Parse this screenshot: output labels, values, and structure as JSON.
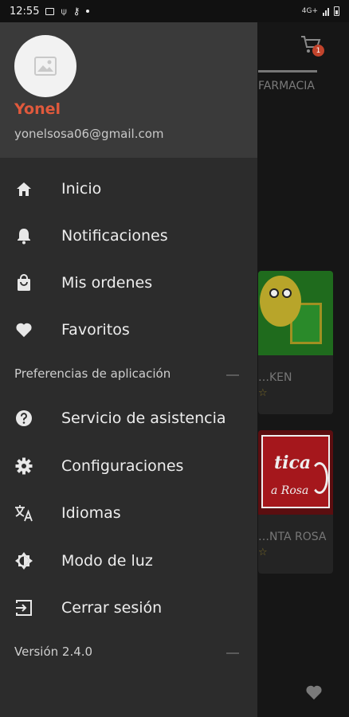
{
  "status_bar": {
    "time": "12:55",
    "network": "4G+"
  },
  "background": {
    "tab_label": "FARMACIA",
    "cart_badge": "1",
    "cards": [
      {
        "name": "…KEN",
        "rating_symbol": "☆"
      },
      {
        "name": "…NTA ROSA",
        "rating_symbol": "☆"
      }
    ],
    "card2_logo_lines": [
      "tica",
      "a Rosa"
    ]
  },
  "drawer": {
    "user": {
      "name": "Yonel",
      "email": "yonelsosa06@gmail.com"
    },
    "main_items": [
      {
        "label": "Inicio",
        "icon": "home-icon"
      },
      {
        "label": "Notificaciones",
        "icon": "bell-icon"
      },
      {
        "label": "Mis ordenes",
        "icon": "shopping-bag-icon"
      },
      {
        "label": "Favoritos",
        "icon": "heart-icon"
      }
    ],
    "preferences_label": "Preferencias de aplicación",
    "preference_items": [
      {
        "label": "Servicio de asistencia",
        "icon": "help-icon"
      },
      {
        "label": "Configuraciones",
        "icon": "gear-icon"
      },
      {
        "label": "Idiomas",
        "icon": "translate-icon"
      },
      {
        "label": "Modo de luz",
        "icon": "brightness-icon"
      },
      {
        "label": "Cerrar sesión",
        "icon": "logout-icon"
      }
    ],
    "version_label": "Versión 2.4.0"
  },
  "colors": {
    "accent": "#e0593c",
    "drawer_bg": "#2c2c2c",
    "header_bg": "#3a3a3a",
    "icon": "#e8e8e8"
  }
}
